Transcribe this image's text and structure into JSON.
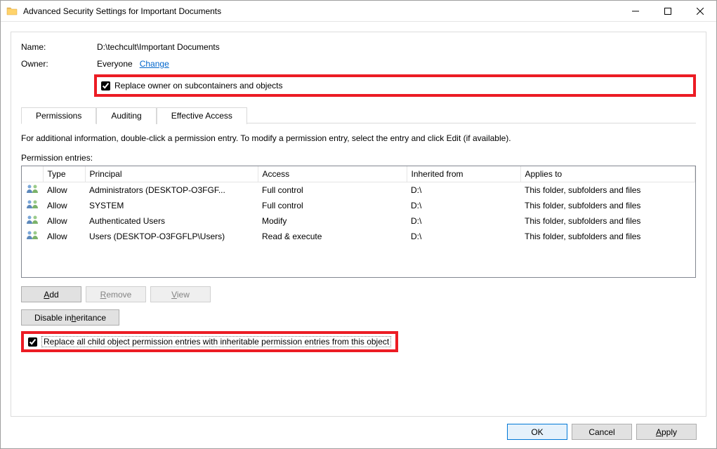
{
  "window": {
    "title": "Advanced Security Settings for Important Documents"
  },
  "info": {
    "name_label": "Name:",
    "name_value": "D:\\techcult\\Important Documents",
    "owner_label": "Owner:",
    "owner_value": "Everyone",
    "change_link": "Change",
    "replace_owner_label": "Replace owner on subcontainers and objects"
  },
  "tabs": {
    "permissions": "Permissions",
    "auditing": "Auditing",
    "effective": "Effective Access"
  },
  "body": {
    "instruction": "For additional information, double-click a permission entry. To modify a permission entry, select the entry and click Edit (if available).",
    "entries_label": "Permission entries:"
  },
  "columns": {
    "type": "Type",
    "principal": "Principal",
    "access": "Access",
    "inherited": "Inherited from",
    "applies": "Applies to"
  },
  "rows": [
    {
      "type": "Allow",
      "principal": "Administrators (DESKTOP-O3FGF...",
      "access": "Full control",
      "inherited": "D:\\",
      "applies": "This folder, subfolders and files"
    },
    {
      "type": "Allow",
      "principal": "SYSTEM",
      "access": "Full control",
      "inherited": "D:\\",
      "applies": "This folder, subfolders and files"
    },
    {
      "type": "Allow",
      "principal": "Authenticated Users",
      "access": "Modify",
      "inherited": "D:\\",
      "applies": "This folder, subfolders and files"
    },
    {
      "type": "Allow",
      "principal": "Users (DESKTOP-O3FGFLP\\Users)",
      "access": "Read & execute",
      "inherited": "D:\\",
      "applies": "This folder, subfolders and files"
    }
  ],
  "buttons": {
    "add": "Add",
    "remove": "Remove",
    "view": "View",
    "disable_inh": "Disable inheritance",
    "replace_child": "Replace all child object permission entries with inheritable permission entries from this object",
    "ok": "OK",
    "cancel": "Cancel",
    "apply": "Apply"
  }
}
